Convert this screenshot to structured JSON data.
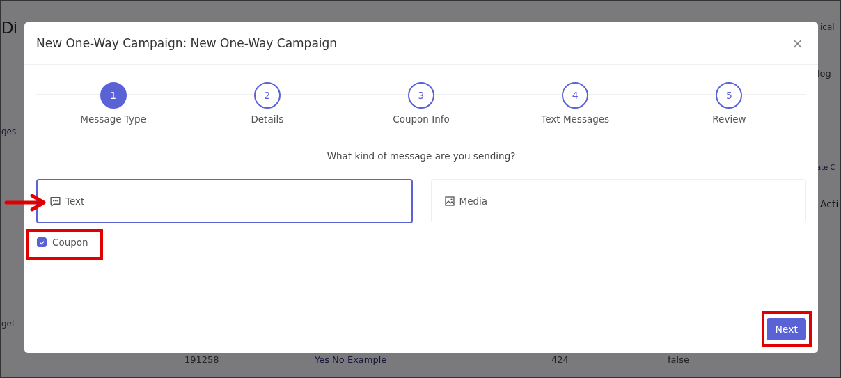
{
  "background": {
    "app_title": "Di",
    "user_name": "ical",
    "tab_label": "log",
    "side_link": "ges",
    "create_button": "ate C",
    "actions_heading": "Acti",
    "side_item": "get",
    "row": {
      "id": "191258",
      "name": "Yes No Example",
      "count": "424",
      "flag": "false"
    }
  },
  "dialog": {
    "title": "New One-Way Campaign: New One-Way Campaign",
    "close": "×",
    "steps": [
      {
        "number": "1",
        "label": "Message Type",
        "selected": true
      },
      {
        "number": "2",
        "label": "Details",
        "selected": false
      },
      {
        "number": "3",
        "label": "Coupon Info",
        "selected": false
      },
      {
        "number": "4",
        "label": "Text Messages",
        "selected": false
      },
      {
        "number": "5",
        "label": "Review",
        "selected": false
      }
    ],
    "question": "What kind of message are you sending?",
    "options": [
      {
        "kind": "text",
        "label": "Text",
        "selected": true
      },
      {
        "kind": "media",
        "label": "Media",
        "selected": false
      }
    ],
    "coupon": {
      "label": "Coupon",
      "checked": true
    },
    "next": "Next"
  }
}
